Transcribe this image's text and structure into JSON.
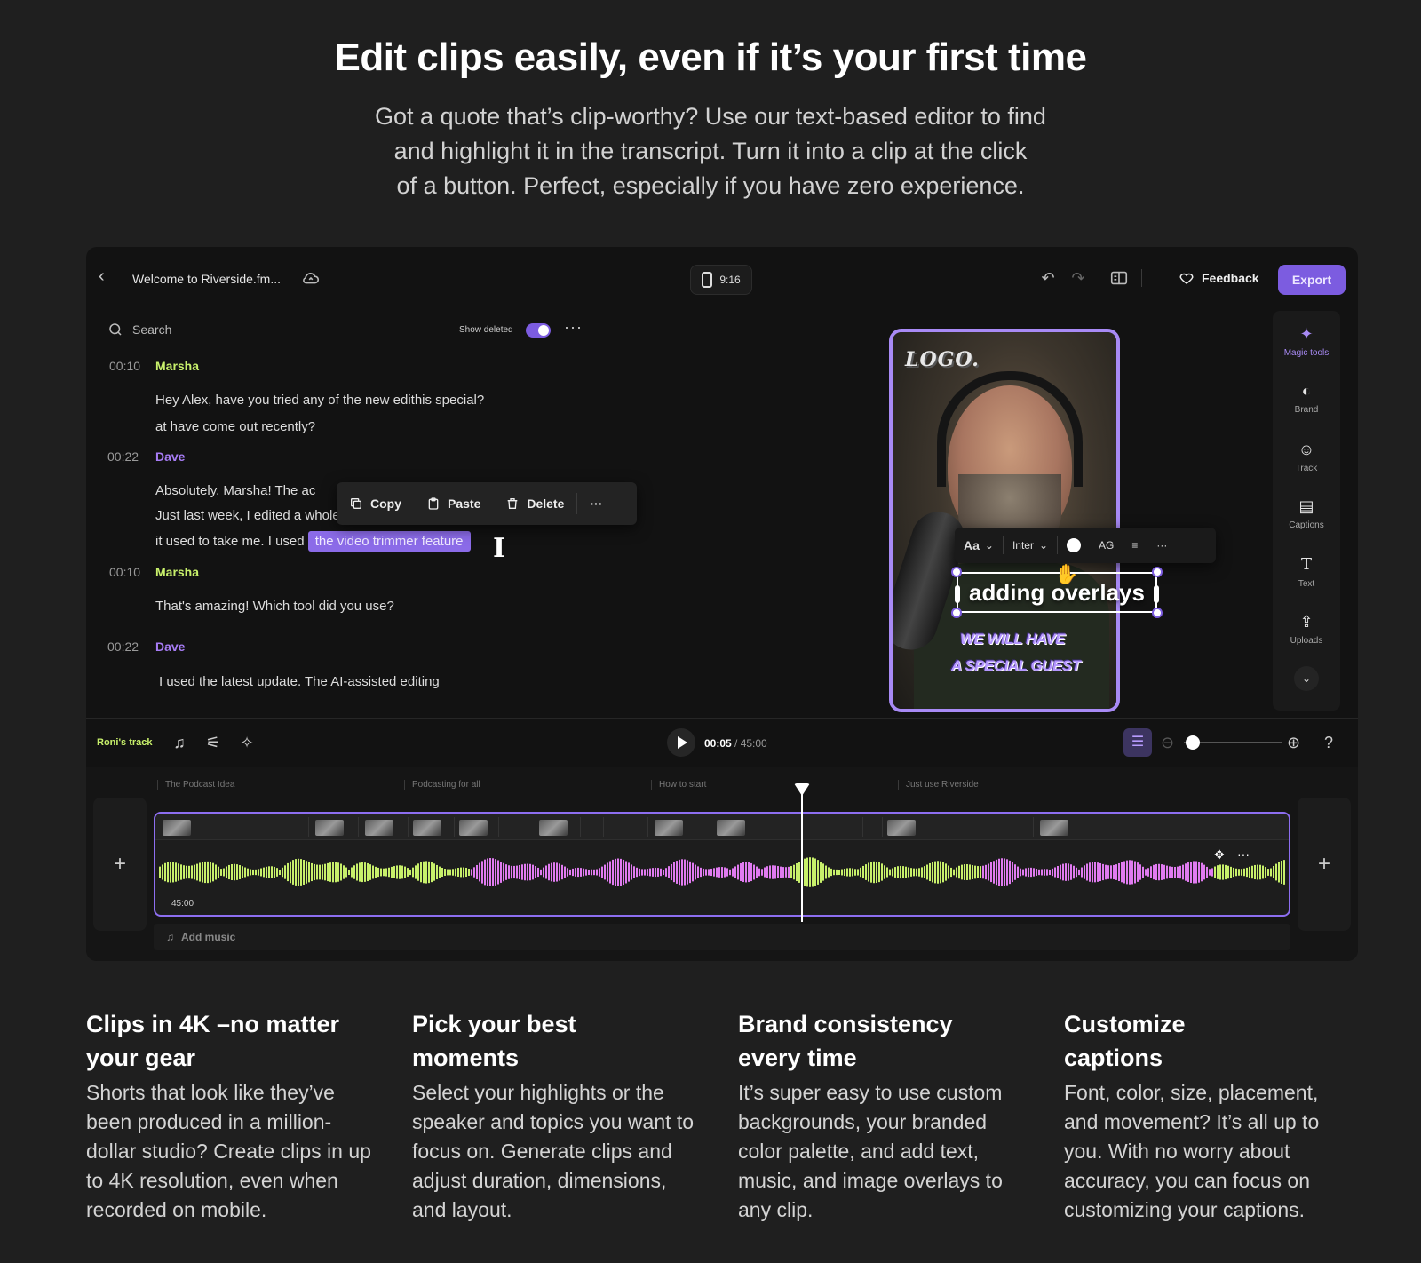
{
  "hero": {
    "title": "Edit clips easily, even if it’s your first time",
    "subtitle_lines": [
      "Got a quote that’s clip-worthy? Use our text-based editor to find",
      "and highlight it in the transcript. Turn it into a clip at the click",
      "of a button. Perfect, especially if you have zero experience."
    ]
  },
  "editor": {
    "doc_title": "Welcome to Riverside.fm...",
    "ratio": "9:16",
    "feedback": "Feedback",
    "export": "Export",
    "search_placeholder": "Search",
    "show_deleted": "Show deleted",
    "transcript": [
      {
        "time": "00:10",
        "speaker": "Marsha",
        "lines": [
          "Hey Alex, have you tried any of the new edithis special?",
          "at have come out recently?"
        ]
      },
      {
        "time": "00:22",
        "speaker": "Dave",
        "lines": [
          "Absolutely, Marsha! The ac",
          "Just last week, I edited a whole podcast in half the time",
          "it used to take me. I used"
        ],
        "highlight": "the video trimmer feature"
      },
      {
        "time": "00:10",
        "speaker": "Marsha",
        "lines": [
          "That's amazing! Which tool did you use?"
        ]
      },
      {
        "time": "00:22",
        "speaker": "Dave",
        "lines": [
          "I used the latest update. The AI-assisted editing"
        ]
      }
    ],
    "context_menu": {
      "copy": "Copy",
      "paste": "Paste",
      "delete": "Delete",
      "more": "···"
    },
    "preview": {
      "logo": "LOGO.",
      "overlay_text": "adding overlays",
      "guest_lines": [
        "WE WILL HAVE",
        "A SPECIAL GUEST"
      ],
      "toolbar": {
        "aa": "Aa",
        "font": "Inter",
        "ag": "AG",
        "more": "···"
      }
    },
    "tools": [
      {
        "label": "Magic tools",
        "icon": "magic-icon"
      },
      {
        "label": "Brand",
        "icon": "palette-icon"
      },
      {
        "label": "Track",
        "icon": "people-icon"
      },
      {
        "label": "Captions",
        "icon": "captions-icon"
      },
      {
        "label": "Text",
        "icon": "text-icon"
      },
      {
        "label": "Uploads",
        "icon": "upload-icon"
      }
    ],
    "timeline": {
      "track_name": "Roni's track",
      "current_time": "00:05",
      "total_time": " / 45:00",
      "chapters": [
        "The Podcast Idea",
        "Podcasting for all",
        "How to start",
        "Just use Riverside"
      ],
      "duration": "45:00",
      "add_music": "Add music"
    },
    "colors": {
      "accent": "#7c5ce0",
      "wave_green": "#c8f06b",
      "wave_pink": "#e07bf0"
    }
  },
  "features": [
    {
      "title_lines": [
        "Clips in 4K –no matter",
        "your gear"
      ],
      "body": "Shorts that look like they’ve been produced in a million-dollar studio? Create clips in up to 4K resolution, even when recorded on mobile."
    },
    {
      "title_lines": [
        "Pick your best",
        "moments"
      ],
      "body": "Select your highlights or the speaker and topics you want to focus on. Generate clips and adjust duration, dimensions, and layout."
    },
    {
      "title_lines": [
        "Brand consistency",
        "every time"
      ],
      "body": "It’s super easy to use custom backgrounds, your branded color palette, and add text, music, and image overlays to any clip."
    },
    {
      "title_lines": [
        "Customize",
        "captions"
      ],
      "body": "Font, color, size, placement, and movement? It’s all up to you. With no worry about accuracy, you can focus on customizing your captions."
    }
  ]
}
